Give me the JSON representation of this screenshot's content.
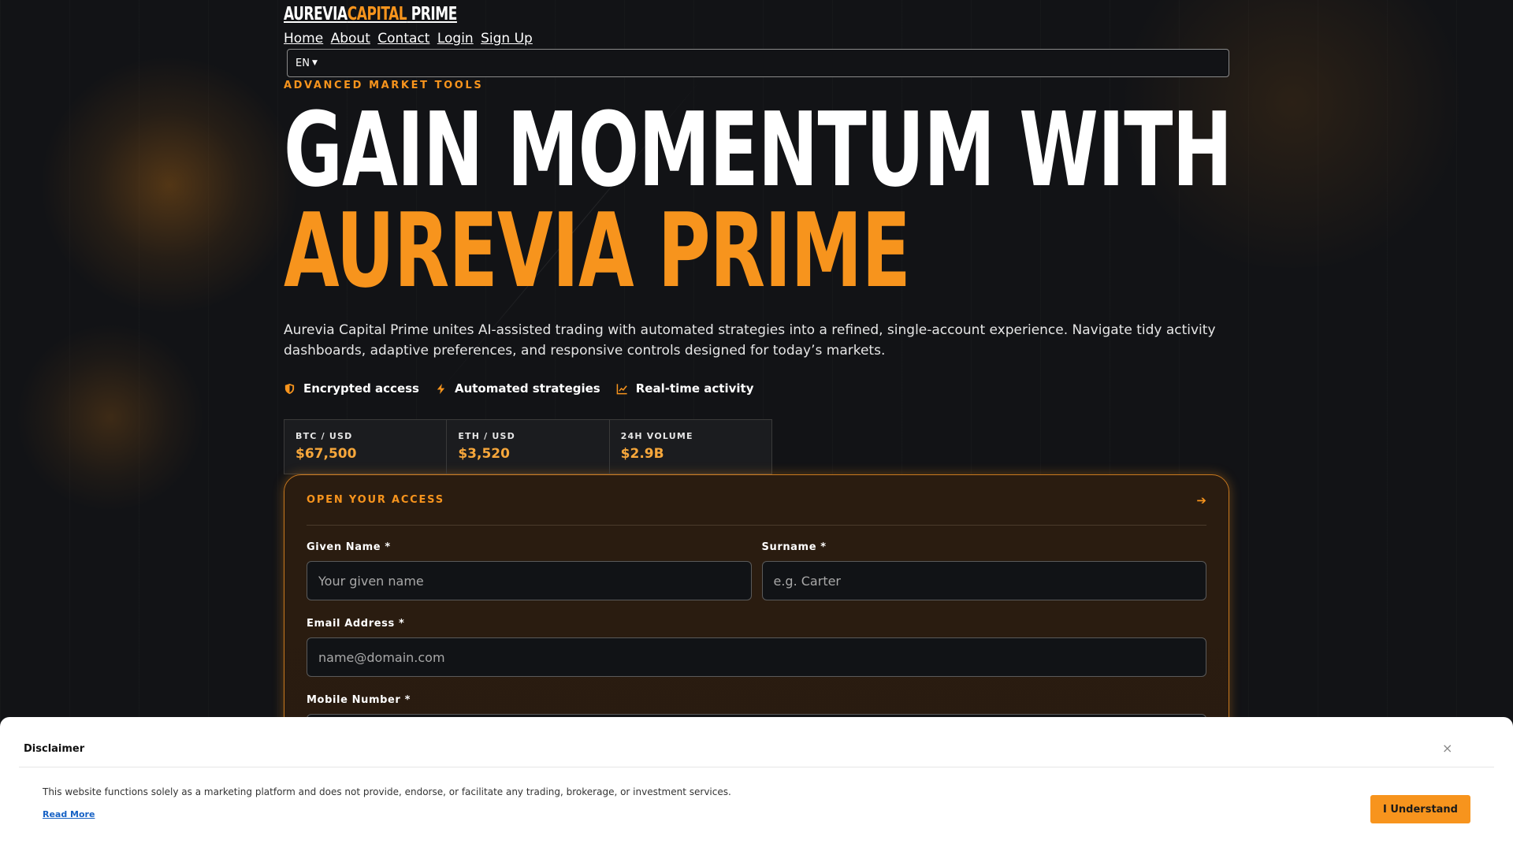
{
  "brand": {
    "name_part1": "AUREVIA",
    "name_part2": "CAPITAL",
    "name_part3": " PRIME",
    "accent_color": "#f7941d"
  },
  "nav": {
    "items": [
      "Home",
      "About",
      "Contact",
      "Login",
      "Sign Up"
    ]
  },
  "language": {
    "selected": "EN"
  },
  "hero": {
    "eyebrow": "ADVANCED MARKET TOOLS",
    "title_line1": "GAIN MOMENTUM WITH",
    "title_line2": "AUREVIA PRIME",
    "description": "Aurevia Capital Prime unites AI-assisted trading with automated strategies into a refined, single-account experience. Navigate tidy activity dash­boards, adaptive preferences, and responsive controls designed for today’s markets."
  },
  "features": [
    {
      "label": "Encrypted access",
      "icon": "shield-icon"
    },
    {
      "label": "Automated strategies",
      "icon": "lightning-icon"
    },
    {
      "label": "Real-time activity",
      "icon": "chart-line-icon"
    }
  ],
  "tickers": [
    {
      "pair": "BTC / USD",
      "value": "$67,500"
    },
    {
      "pair": "ETH / USD",
      "value": "$3,520"
    },
    {
      "pair": "24H VOLUME",
      "value": "$2.9B"
    }
  ],
  "form": {
    "title": "OPEN YOUR ACCESS",
    "given_name": {
      "label": "Given Name *",
      "placeholder": "Your given name"
    },
    "surname": {
      "label": "Surname *",
      "placeholder": "e.g. Carter"
    },
    "email": {
      "label": "Email Address *",
      "placeholder": "name@domain.com"
    },
    "mobile": {
      "label": "Mobile Number *",
      "placeholder": ""
    }
  },
  "disclaimer": {
    "title": "Disclaimer",
    "text": "This website functions solely as a marketing platform and does not provide, endorse, or facilitate any trading, brokerage, or investment services.",
    "read_more": "Read More",
    "button": "I Understand"
  }
}
